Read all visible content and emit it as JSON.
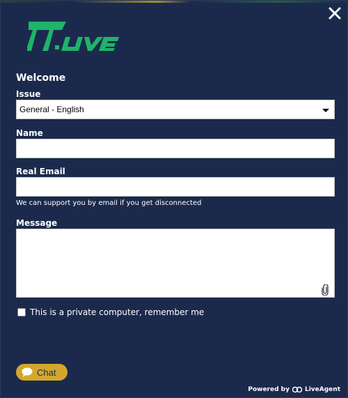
{
  "header": {
    "logo_text": "777.LIVE",
    "close_icon": "close-icon"
  },
  "form": {
    "welcome": "Welcome",
    "issue_label": "Issue",
    "issue_selected": "General - English",
    "name_label": "Name",
    "name_value": "",
    "email_label": "Real Email",
    "email_value": "",
    "email_hint": "We can support you by email if you get disconnected",
    "message_label": "Message",
    "message_value": "",
    "attach_icon": "paperclip-icon",
    "remember_label": "This is a private computer, remember me",
    "remember_checked": false
  },
  "footer": {
    "chat_label": "Chat",
    "chat_icon": "chat-bubble-icon",
    "powered_prefix": "Powered by",
    "powered_brand": "LiveAgent"
  },
  "colors": {
    "background": "#1b2a4c",
    "logo_green": "#1fb36b",
    "accent_gold": "#d4a72c",
    "text": "#ffffff"
  }
}
